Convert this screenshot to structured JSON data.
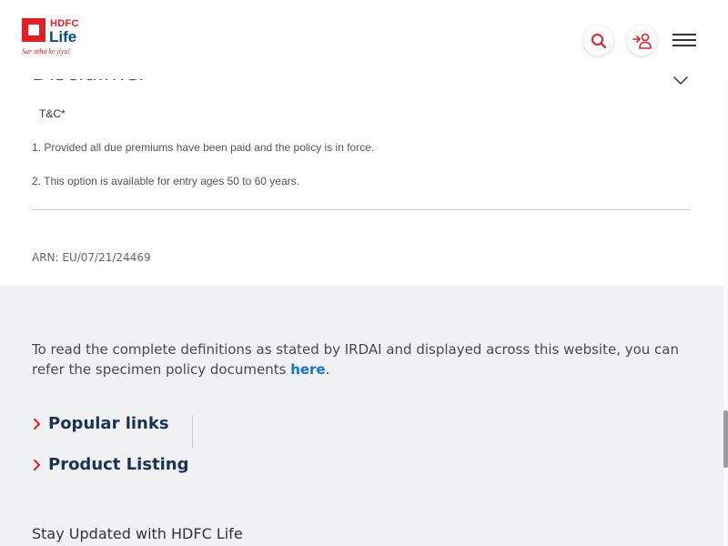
{
  "header": {
    "logo": {
      "brand": "HDFC",
      "product": "Life",
      "tagline": "Sar utha ke jiyo!"
    },
    "search_icon": "search-icon",
    "login_icon": "user-login-icon",
    "menu_icon": "hamburger-menu-icon"
  },
  "disclaimer": {
    "title": "Disclaimer",
    "tnc_label": "T&C*",
    "items": [
      "1. Provided all due premiums have been paid and the policy is in force.",
      "2. This option is available for entry ages 50 to 60 years."
    ],
    "arn": "ARN: EU/07/21/24469"
  },
  "footer": {
    "irdai_text": "To read the complete definitions as stated by IRDAI and displayed across this website, you can refer the specimen policy documents ",
    "irdai_link": "here",
    "irdai_end": ".",
    "links": [
      {
        "label": "Popular links"
      },
      {
        "label": "Product Listing"
      }
    ],
    "stay_updated": "Stay Updated with HDFC Life"
  },
  "colors": {
    "brand_red": "#e31e24",
    "brand_blue": "#004c8f",
    "link_blue": "#1a73c9",
    "footer_bg": "#eff1f2",
    "heading_navy": "#1d3352"
  }
}
